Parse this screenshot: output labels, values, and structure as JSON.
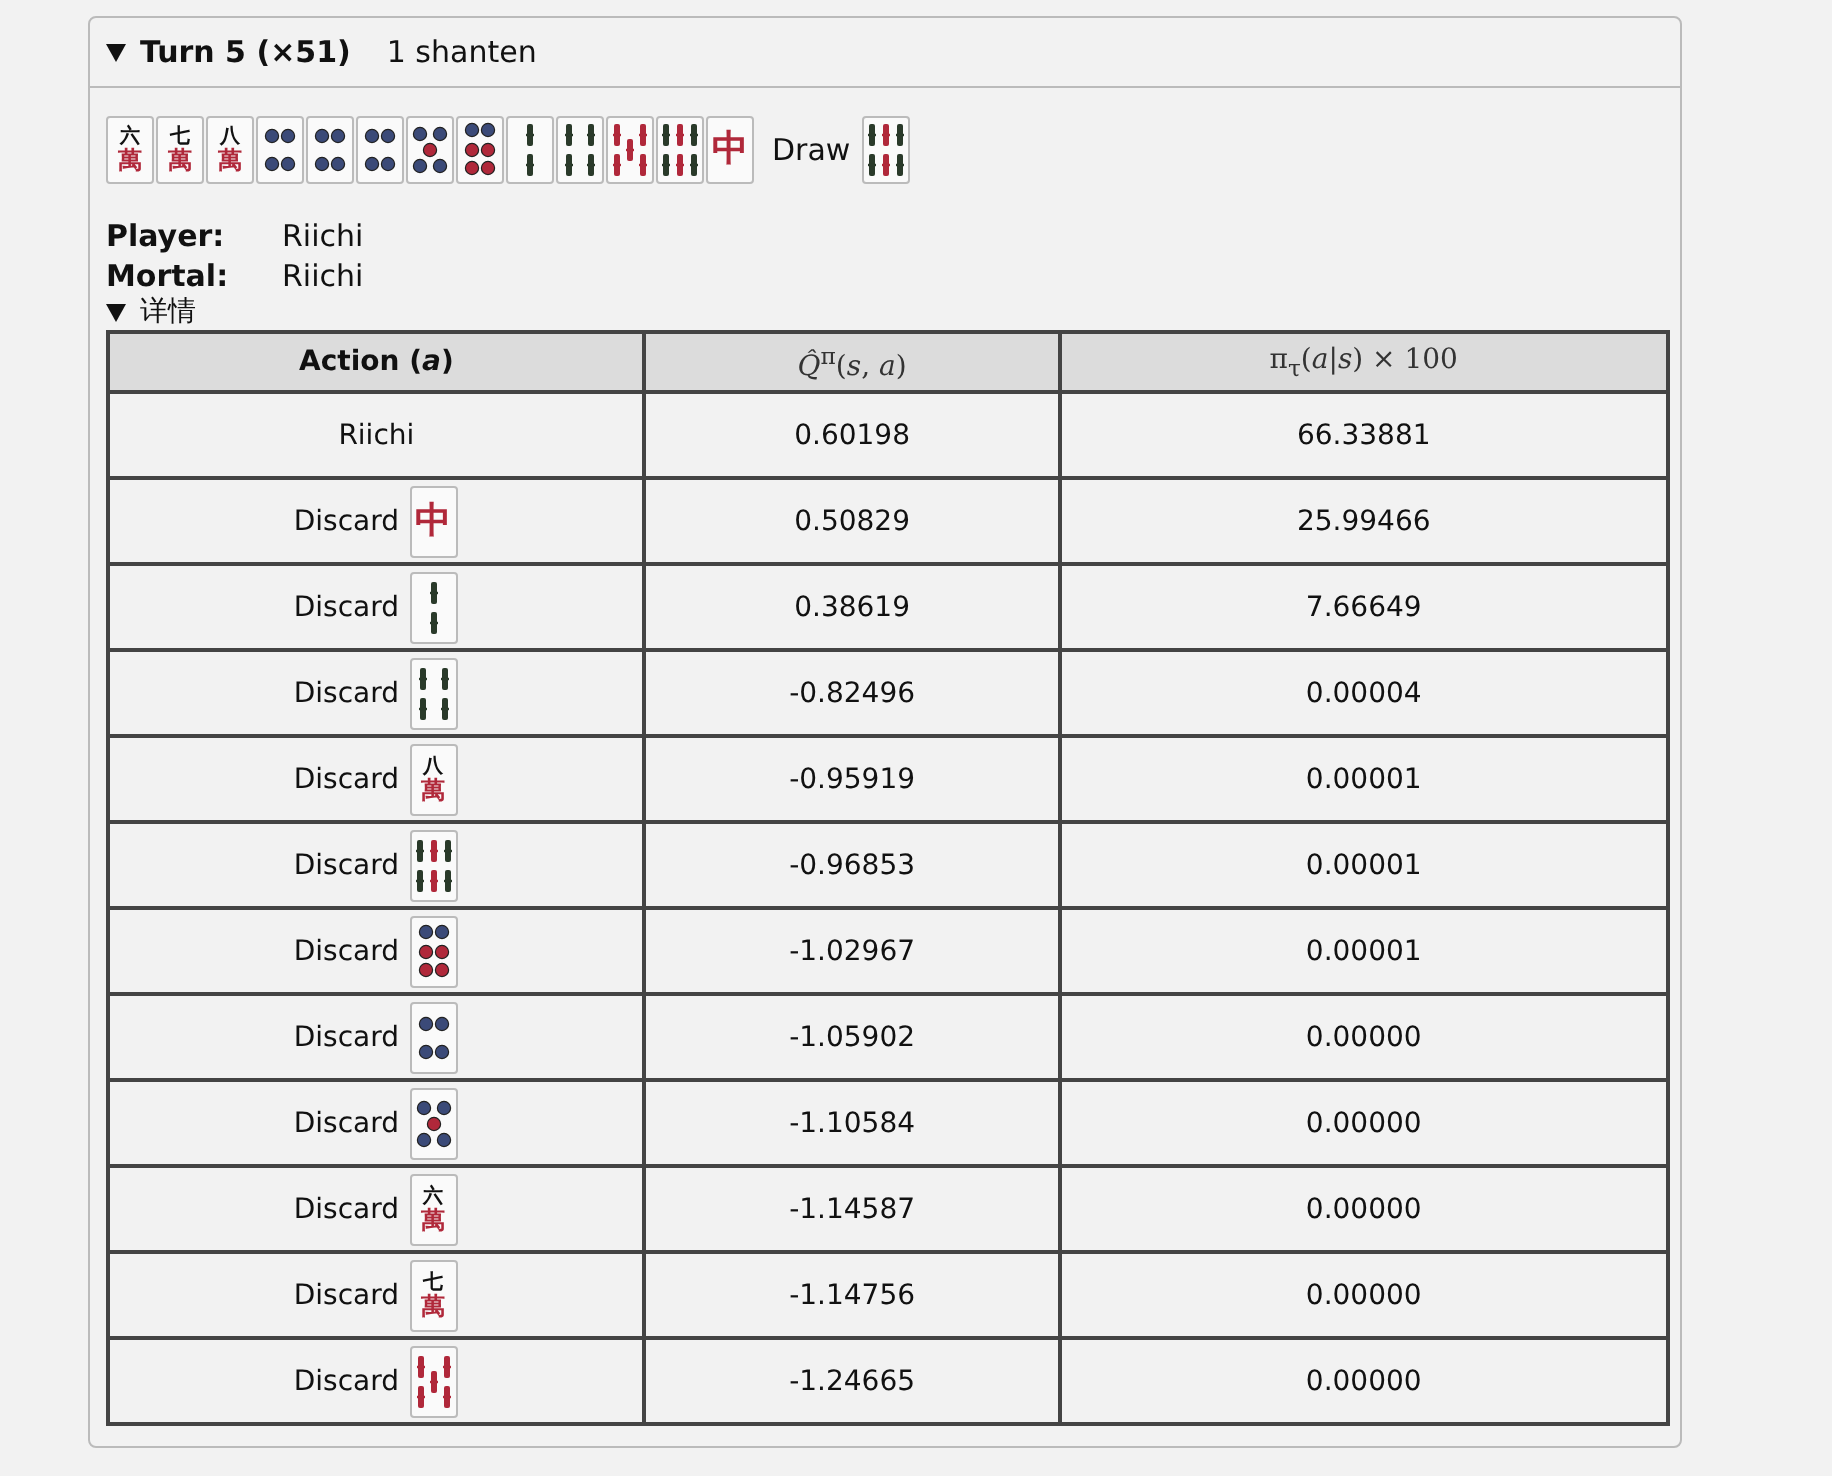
{
  "turn": {
    "title": "Turn 5 (×51)",
    "expanded": true,
    "shanten": "1 shanten"
  },
  "hand": [
    {
      "kind": "man",
      "rank": "六",
      "suit": "萬"
    },
    {
      "kind": "man",
      "rank": "七",
      "suit": "萬"
    },
    {
      "kind": "man",
      "rank": "八",
      "suit": "萬"
    },
    {
      "kind": "pin4"
    },
    {
      "kind": "pin4"
    },
    {
      "kind": "pin4"
    },
    {
      "kind": "pin5"
    },
    {
      "kind": "pin6"
    },
    {
      "kind": "sou2"
    },
    {
      "kind": "sou4"
    },
    {
      "kind": "sou5red"
    },
    {
      "kind": "sou6"
    },
    {
      "kind": "honor",
      "face": "中"
    }
  ],
  "draw": {
    "label": "Draw",
    "tile": {
      "kind": "sou6"
    }
  },
  "info": [
    {
      "label": "Player:",
      "value": "Riichi"
    },
    {
      "label": "Mortal:",
      "value": "Riichi"
    }
  ],
  "details": {
    "label": "详情",
    "expanded": true
  },
  "table": {
    "columns": [
      "Action (*a*)",
      "*Q̂*$^{π}$(*s*, *a*)",
      "π$_{τ}$(*a*|*s*) × 100"
    ],
    "rows": [
      {
        "action": "Riichi",
        "q": "0.60198",
        "pi": "66.33881"
      },
      {
        "action": "Discard",
        "tile": {
          "kind": "honor",
          "face": "中"
        },
        "q": "0.50829",
        "pi": "25.99466"
      },
      {
        "action": "Discard",
        "tile": {
          "kind": "sou2"
        },
        "q": "0.38619",
        "pi": "7.66649"
      },
      {
        "action": "Discard",
        "tile": {
          "kind": "sou4"
        },
        "q": "-0.82496",
        "pi": "0.00004"
      },
      {
        "action": "Discard",
        "tile": {
          "kind": "man",
          "rank": "八",
          "suit": "萬"
        },
        "q": "-0.95919",
        "pi": "0.00001"
      },
      {
        "action": "Discard",
        "tile": {
          "kind": "sou6"
        },
        "q": "-0.96853",
        "pi": "0.00001"
      },
      {
        "action": "Discard",
        "tile": {
          "kind": "pin6"
        },
        "q": "-1.02967",
        "pi": "0.00001"
      },
      {
        "action": "Discard",
        "tile": {
          "kind": "pin4"
        },
        "q": "-1.05902",
        "pi": "0.00000"
      },
      {
        "action": "Discard",
        "tile": {
          "kind": "pin5"
        },
        "q": "-1.10584",
        "pi": "0.00000"
      },
      {
        "action": "Discard",
        "tile": {
          "kind": "man",
          "rank": "六",
          "suit": "萬"
        },
        "q": "-1.14587",
        "pi": "0.00000"
      },
      {
        "action": "Discard",
        "tile": {
          "kind": "man",
          "rank": "七",
          "suit": "萬"
        },
        "q": "-1.14756",
        "pi": "0.00000"
      },
      {
        "action": "Discard",
        "tile": {
          "kind": "sou5red"
        },
        "q": "-1.24665",
        "pi": "0.00000"
      }
    ]
  }
}
